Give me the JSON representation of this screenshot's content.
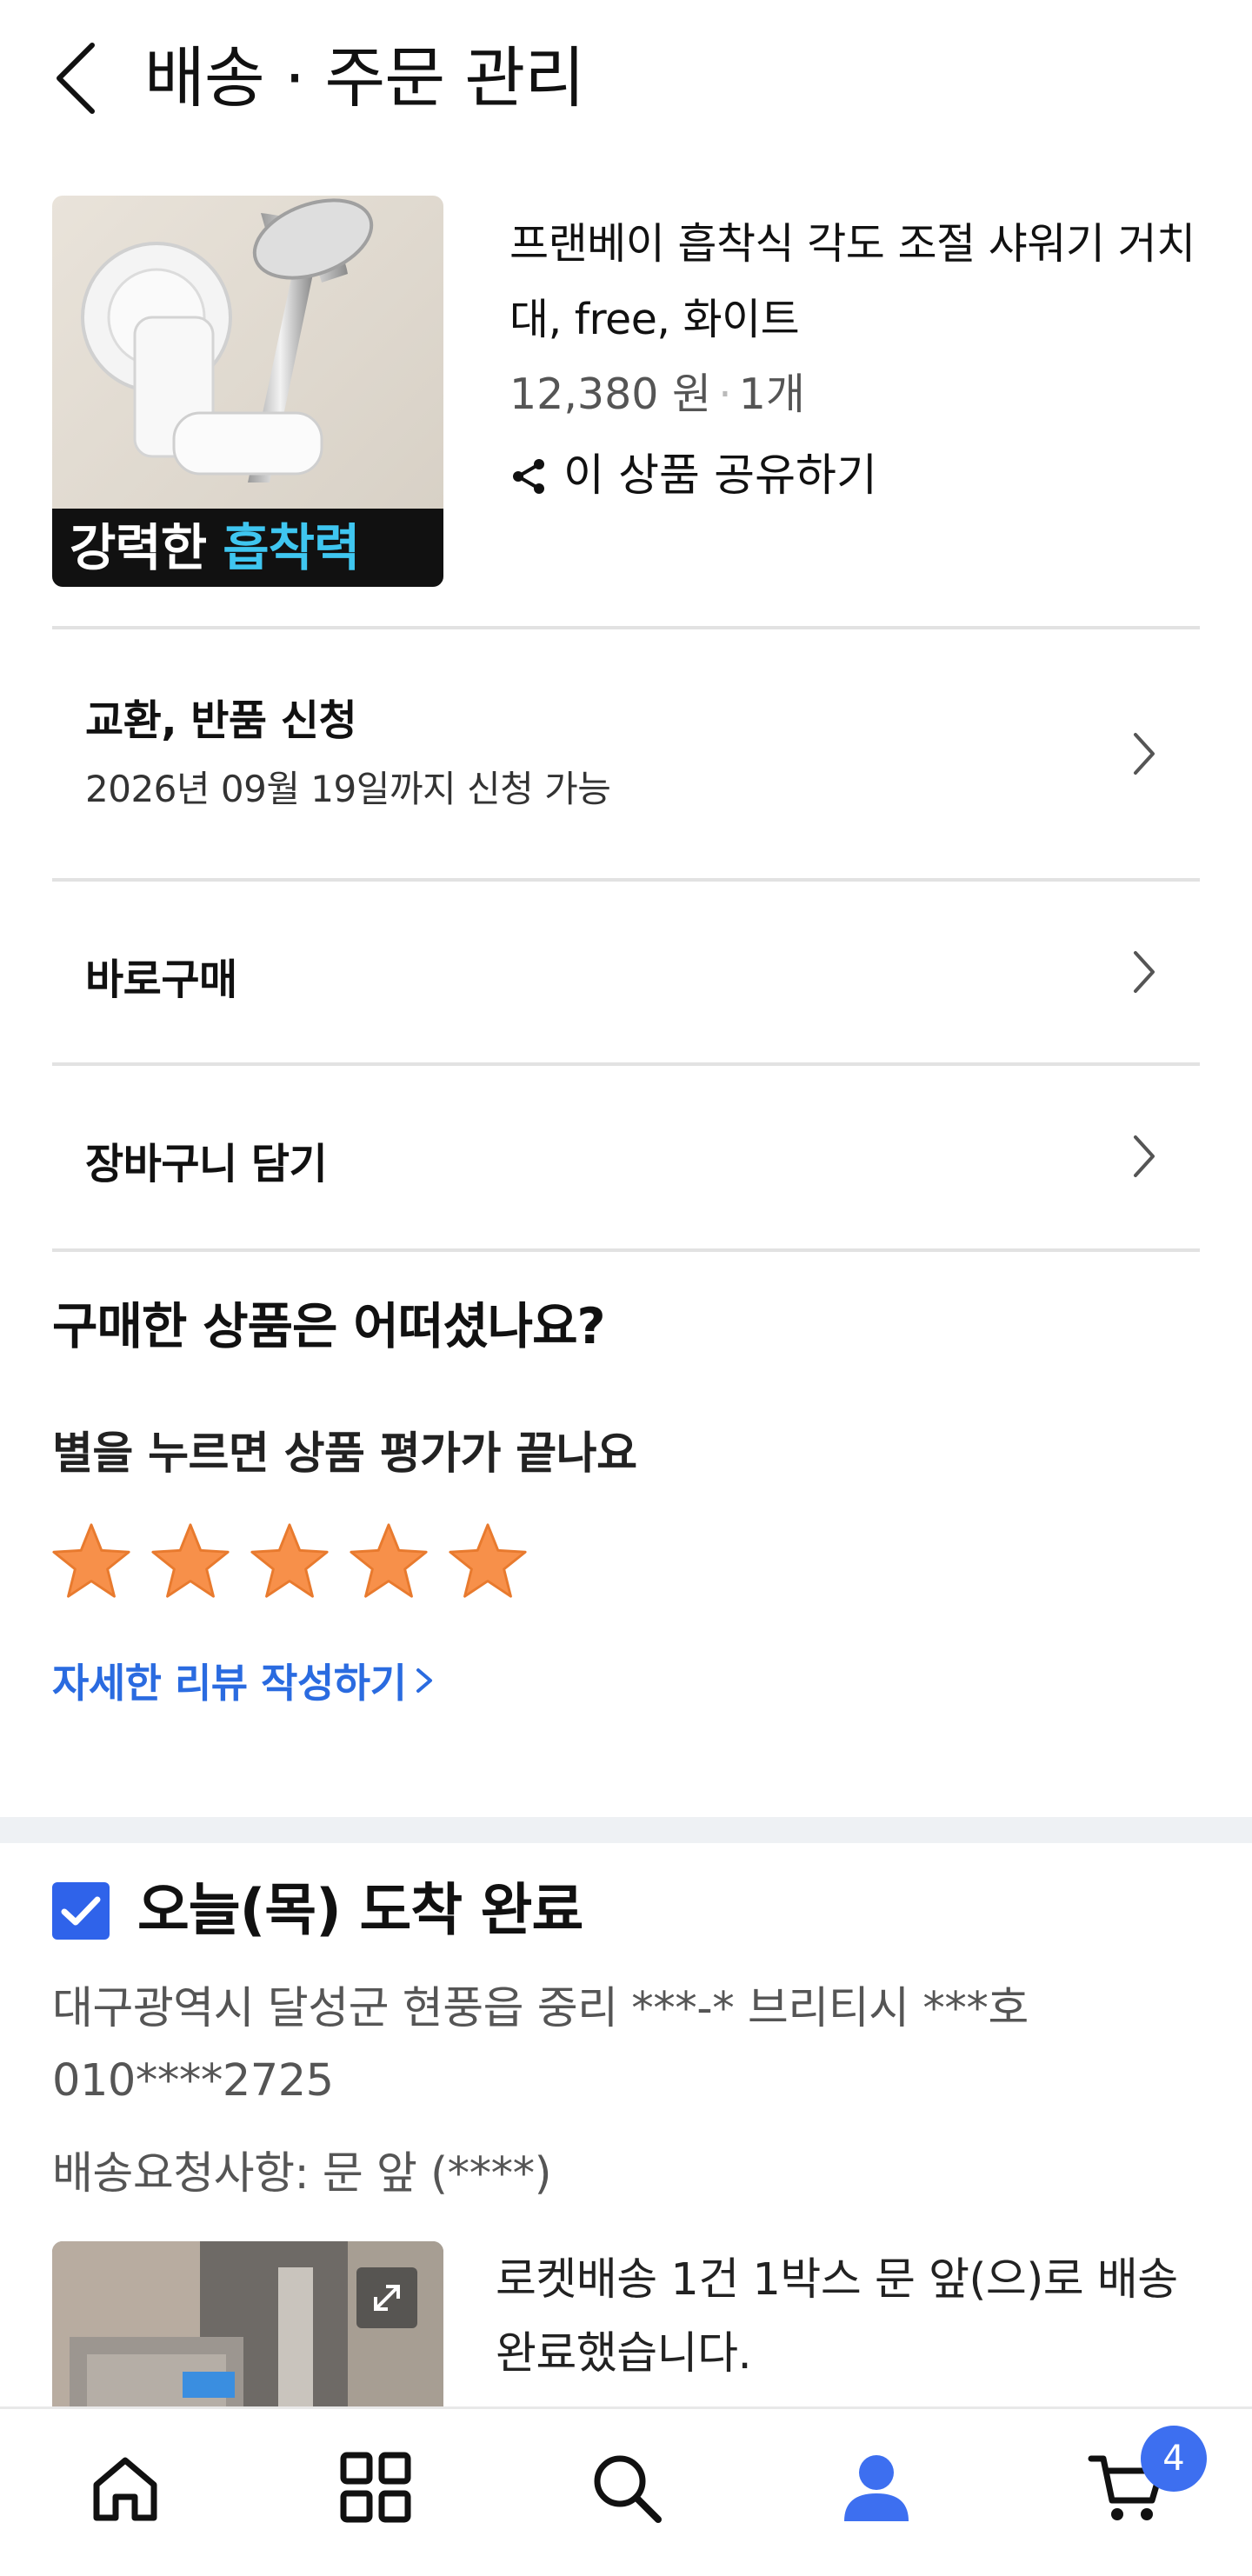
{
  "header": {
    "title": "배송 · 주문 관리"
  },
  "product": {
    "name": "프랜베이 흡착식 각도 조절 샤워기 거치대, free, 화이트",
    "price": "12,380 원",
    "quantity": "1개",
    "share_label": "이 상품 공유하기",
    "image_caption_white": "강력한",
    "image_caption_blue": "흡착력"
  },
  "menu": {
    "exchange_title": "교환, 반품 신청",
    "exchange_sub": "2026년 09월 19일까지 신청 가능",
    "buy_now": "바로구매",
    "add_cart": "장바구니 담기"
  },
  "evaluation": {
    "title": "구매한 상품은 어떠셨나요?",
    "subtitle": "별을 누르면 상품 평가가 끝나요",
    "star_count": 5,
    "review_link": "자세한 리뷰 작성하기"
  },
  "delivery": {
    "status": "오늘(목) 도착 완료",
    "address": "대구광역시 달성군 현풍읍 중리 ***-* 브리티시 ***호",
    "phone": "010****2725",
    "request": "배송요청사항:  문 앞 (****)",
    "message": "로켓배송 1건 1박스 문 앞(으)로 배송 완료했습니다."
  },
  "tabbar": {
    "cart_count": "4",
    "active_tab": "my"
  },
  "colors": {
    "accent_blue": "#2f63ea",
    "star_orange": "#f7904a",
    "link_blue": "#2a6be0"
  }
}
